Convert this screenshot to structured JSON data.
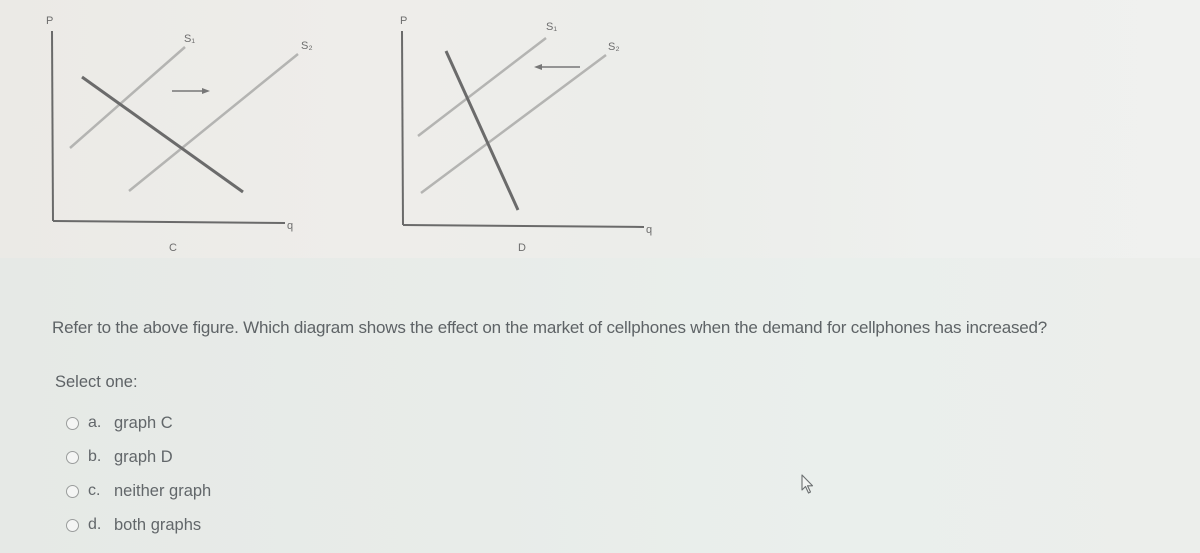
{
  "figures": [
    {
      "caption": "C",
      "y_axis_label": "P",
      "x_axis_label": "q",
      "curves": [
        {
          "label": "S₁",
          "type": "supply",
          "role": "original supply"
        },
        {
          "label": "S₂",
          "type": "supply",
          "role": "shifted supply"
        },
        {
          "label": "",
          "type": "demand",
          "role": "demand"
        }
      ],
      "shift_arrow": "right"
    },
    {
      "caption": "D",
      "y_axis_label": "P",
      "x_axis_label": "q",
      "curves": [
        {
          "label": "S₁",
          "type": "supply",
          "role": "shifted supply"
        },
        {
          "label": "S₂",
          "type": "supply",
          "role": "original supply"
        },
        {
          "label": "",
          "type": "demand",
          "role": "demand"
        }
      ],
      "shift_arrow": "left"
    }
  ],
  "question": {
    "text": "Refer to the above figure. Which diagram shows the effect on the market of cellphones when the demand for cellphones has increased?",
    "prompt": "Select one:",
    "options": [
      {
        "letter": "a.",
        "text": "graph C",
        "selected": false
      },
      {
        "letter": "b.",
        "text": "graph D",
        "selected": false
      },
      {
        "letter": "c.",
        "text": "neither graph",
        "selected": false
      },
      {
        "letter": "d.",
        "text": "both graphs",
        "selected": false
      }
    ]
  },
  "colors": {
    "axis": "#6a6a6a",
    "supply_line": "#b4b4b2",
    "demand_line": "#6b6b6b",
    "text": "#5e6366"
  },
  "cursor": {
    "icon": "mouse-pointer-icon"
  }
}
